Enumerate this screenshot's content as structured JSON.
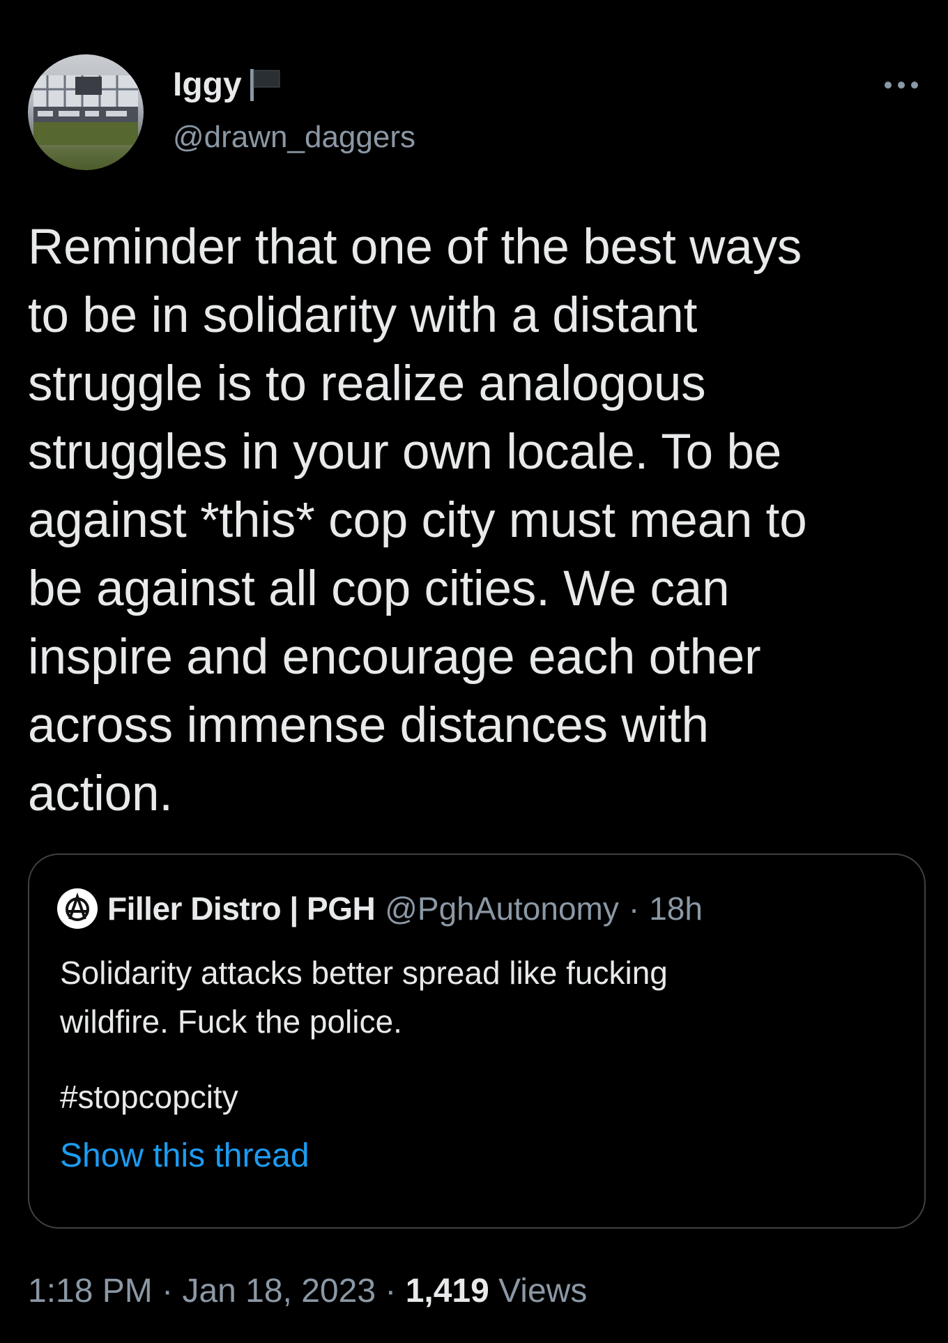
{
  "author": {
    "display_name": "Iggy",
    "handle": "@drawn_daggers",
    "badge_icon": "flag-icon",
    "avatar_icon": "avatar-building-photo"
  },
  "more_icon": "more-horizontal-icon",
  "body_lines": [
    "Reminder that one of the best ways",
    "to be in solidarity with a distant",
    "struggle is to realize analogous",
    "struggles in your own locale. To be",
    "against *this* cop city must mean to",
    "be against all cop cities. We can",
    "inspire and encourage each other",
    "across immense distances with",
    "action."
  ],
  "quoted": {
    "display_name": "Filler Distro | PGH",
    "handle": "@PghAutonomy",
    "separator": "·",
    "time_ago": "18h",
    "text_lines": [
      "Solidarity attacks better spread like fucking",
      "wildfire. Fuck the police."
    ],
    "hashtag": "#stopcopcity",
    "show_thread": "Show this thread",
    "avatar_icon": "anarchy-logo-icon"
  },
  "footer": {
    "time": "1:18 PM",
    "sep1": "·",
    "date": "Jan 18, 2023",
    "sep2": "·",
    "views_count": "1,419",
    "views_label": "Views"
  },
  "colors": {
    "background": "#000000",
    "text": "#e7e9ea",
    "secondary": "#8b98a5",
    "link": "#1d9bf0",
    "border": "#3e4144"
  }
}
